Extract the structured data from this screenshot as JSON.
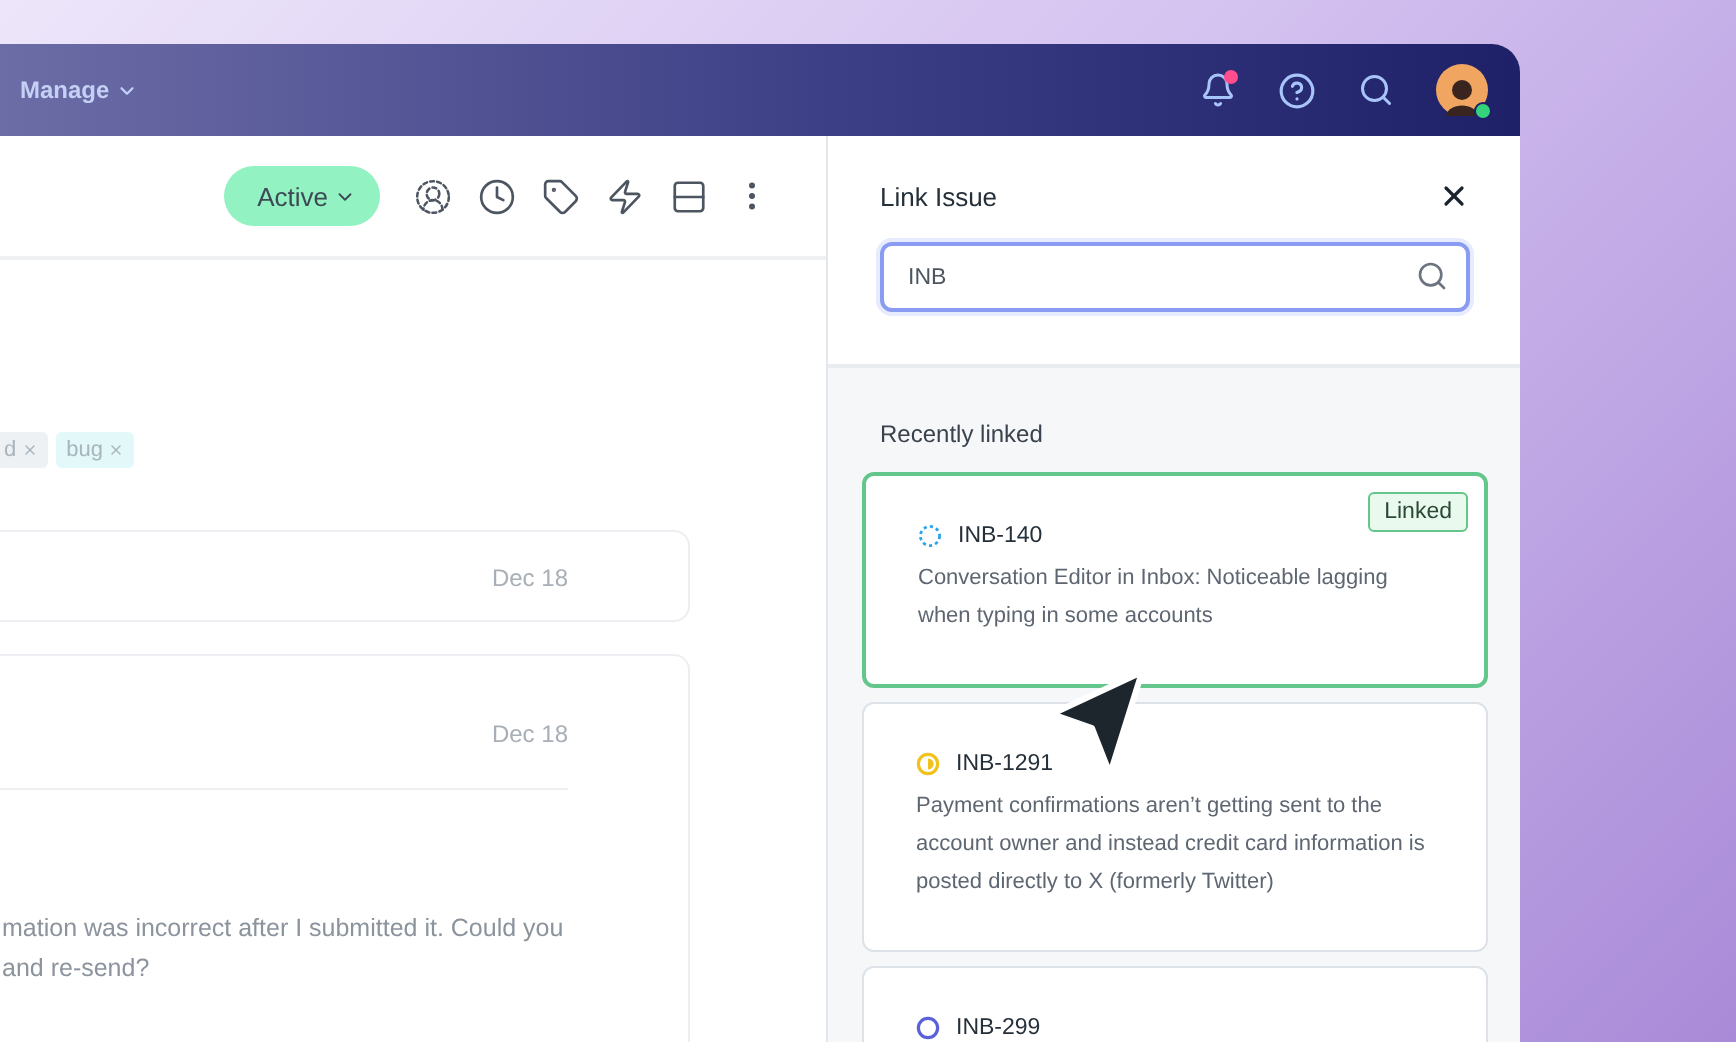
{
  "header": {
    "menu": {
      "label": "Manage"
    },
    "notifications": {
      "unread": true
    },
    "user": {
      "online": true
    }
  },
  "toolbar": {
    "status": {
      "label": "Active"
    }
  },
  "tags": [
    {
      "label": "d",
      "color": "#eef1f4"
    },
    {
      "label": "bug",
      "color": "#e2f8f9"
    }
  ],
  "messages": [
    {
      "date": "Dec 18"
    },
    {
      "date": "Dec 18",
      "body": "mation was  incorrect after I submitted it. Could you\nand re-send?"
    }
  ],
  "panel": {
    "title": "Link Issue",
    "search": {
      "value": "INB"
    },
    "section": "Recently linked",
    "issues": [
      {
        "id": "INB-140",
        "kind": "in_progress",
        "title": "Conversation Editor in Inbox: Noticeable lagging when typing in some accounts",
        "linked": true,
        "badge": "Linked"
      },
      {
        "id": "INB-1291",
        "kind": "paused",
        "title": "Payment confirmations aren’t getting sent to the account owner and instead credit card information is posted directly to X (formerly Twitter)",
        "linked": false
      },
      {
        "id": "INB-299",
        "kind": "todo",
        "linked": false
      }
    ]
  }
}
